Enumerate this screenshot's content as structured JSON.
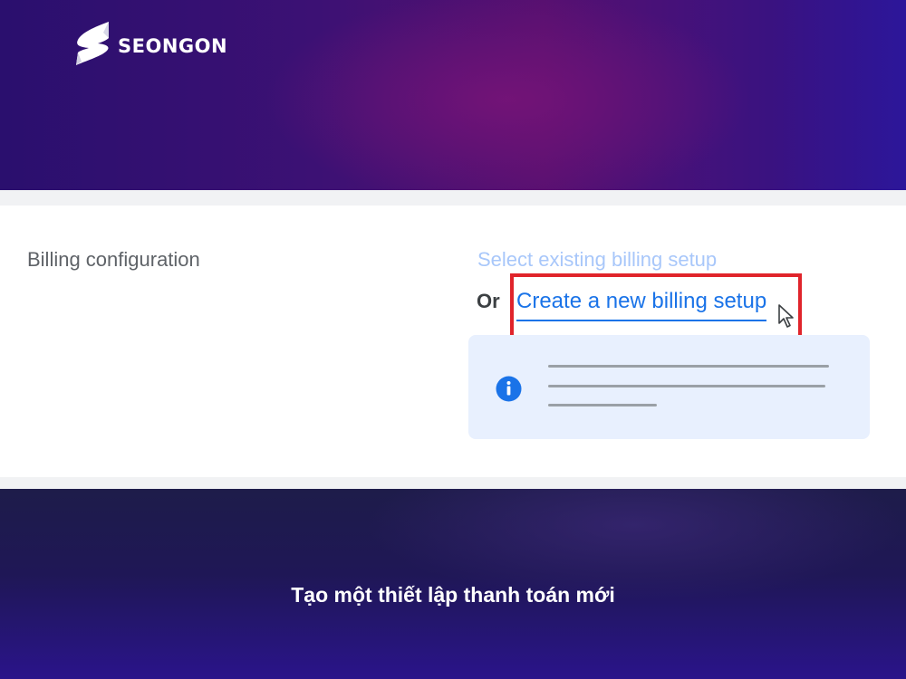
{
  "brand": {
    "logo_text": "SEONGON"
  },
  "billing": {
    "section_label": "Billing configuration",
    "select_existing_label": "Select existing billing setup",
    "or_label": "Or",
    "create_new_label": "Create a new billing setup"
  },
  "info_box": {
    "icon": "info-icon"
  },
  "caption": "Tạo một thiết lập thanh toán mới",
  "colors": {
    "link": "#1a73e8",
    "highlight": "#e0242b",
    "info_background": "#e8f0fe"
  }
}
